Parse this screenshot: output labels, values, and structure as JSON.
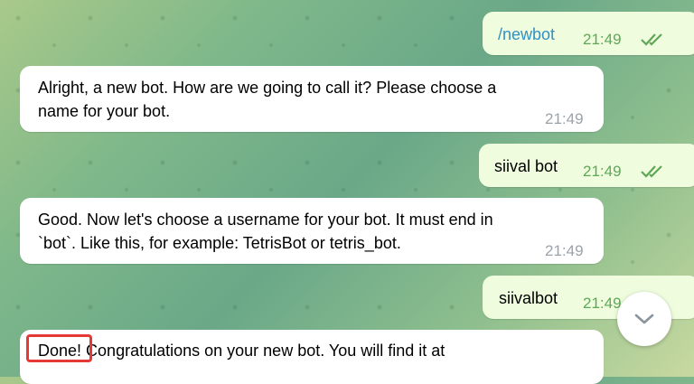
{
  "messages": [
    {
      "text": "/newbot",
      "time": "21:49",
      "direction": "outgoing",
      "status": "read"
    },
    {
      "line1": "Alright, a new bot. How are we going to call it? Please choose a",
      "line2": "name for your bot.",
      "time": "21:49",
      "direction": "incoming"
    },
    {
      "text": "siival bot",
      "time": "21:49",
      "direction": "outgoing",
      "status": "read"
    },
    {
      "line1": "Good. Now let's choose a username for your bot. It must end in",
      "line2": "`bot`. Like this, for example: TetrisBot or tetris_bot.",
      "time": "21:49",
      "direction": "incoming"
    },
    {
      "text": "siivalbot",
      "time": "21:49",
      "direction": "outgoing",
      "status": "read"
    },
    {
      "highlight": "Done!",
      "rest": " Congratulations on your new bot. You will find it at",
      "direction": "incoming"
    }
  ],
  "scroll_button": {
    "icon": "chevron-down-icon"
  },
  "colors": {
    "outgoing_bubble": "#effdde",
    "incoming_bubble": "#ffffff",
    "check_color": "#5fa757",
    "command_link": "#3390c7",
    "highlight_border": "#e53935"
  }
}
